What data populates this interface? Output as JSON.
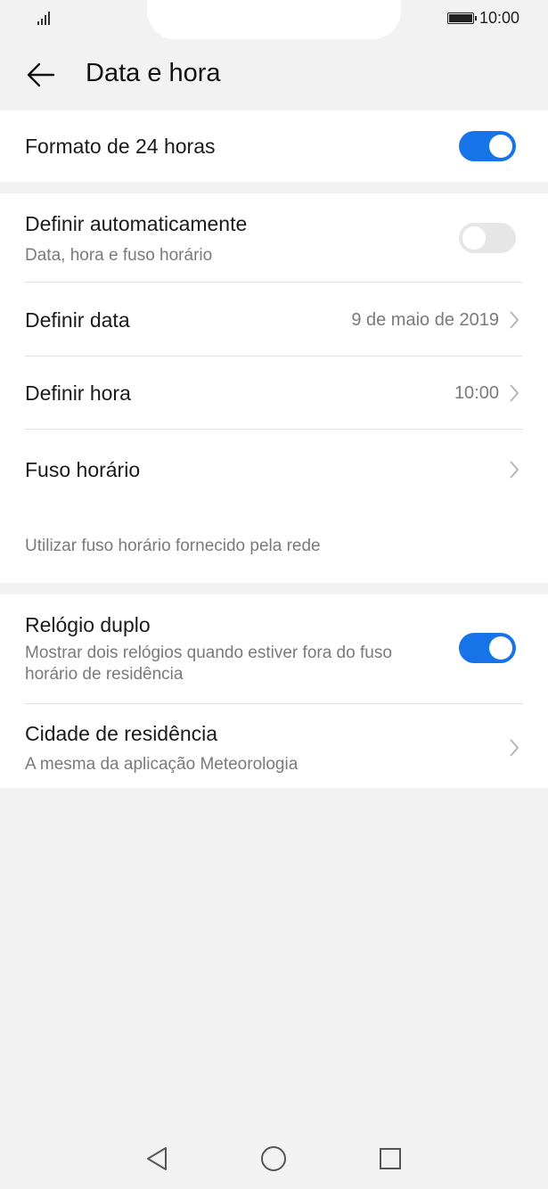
{
  "status": {
    "time": "10:00"
  },
  "header": {
    "title": "Data e hora"
  },
  "rows": {
    "format24": {
      "label": "Formato de 24 horas",
      "enabled": true
    },
    "auto": {
      "label": "Definir automaticamente",
      "sub": "Data, hora e fuso horário",
      "enabled": false
    },
    "setDate": {
      "label": "Definir data",
      "value": "9 de maio de 2019"
    },
    "setTime": {
      "label": "Definir hora",
      "value": "10:00"
    },
    "timezone": {
      "label": "Fuso horário",
      "hint": "Utilizar fuso horário fornecido pela rede"
    },
    "dualClock": {
      "label": "Relógio duplo",
      "sub": "Mostrar dois relógios quando estiver fora do fuso horário de residência",
      "enabled": true
    },
    "homeCity": {
      "label": "Cidade de residência",
      "sub": "A mesma da aplicação Meteorologia"
    }
  },
  "icons": {
    "back": "arrow-left-icon",
    "chevron": "chevron-right-icon",
    "signal": "signal-icon",
    "battery": "battery-icon",
    "navBack": "triangle-back-icon",
    "navHome": "circle-home-icon",
    "navRecent": "square-recent-icon"
  },
  "colors": {
    "accent": "#1673e8",
    "toggleOff": "#e6e6e6",
    "background": "#f2f2f2"
  }
}
